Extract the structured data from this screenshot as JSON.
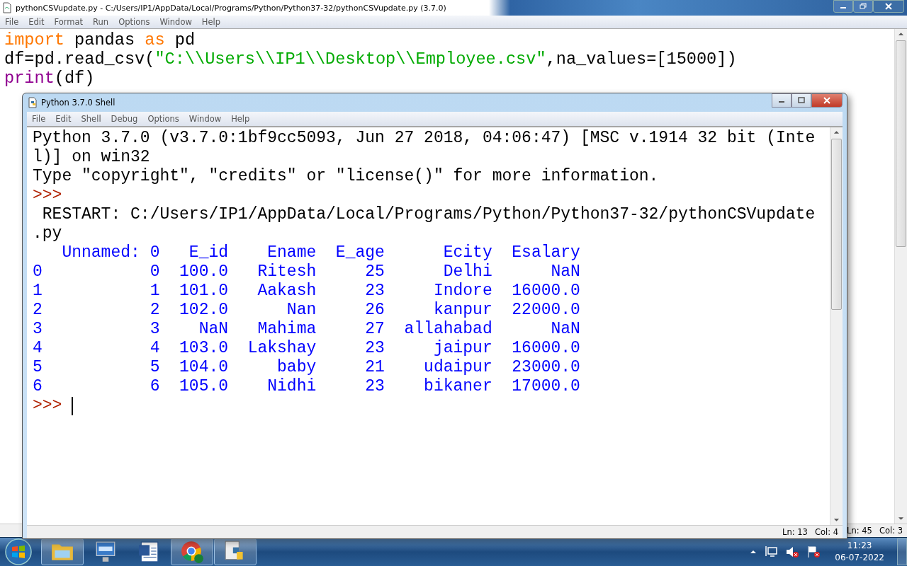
{
  "editor": {
    "title": "pythonCSVupdate.py - C:/Users/IP1/AppData/Local/Programs/Python/Python37-32/pythonCSVupdate.py (3.7.0)",
    "menu": [
      "File",
      "Edit",
      "Format",
      "Run",
      "Options",
      "Window",
      "Help"
    ],
    "code_lines": [
      [
        {
          "kind": "keyword",
          "text": "import"
        },
        {
          "kind": "plain",
          "text": " pandas "
        },
        {
          "kind": "keyword",
          "text": "as"
        },
        {
          "kind": "plain",
          "text": " pd"
        }
      ],
      [
        {
          "kind": "plain",
          "text": "df=pd.read_csv("
        },
        {
          "kind": "string",
          "text": "\"C:\\\\Users\\\\IP1\\\\Desktop\\\\Employee.csv\""
        },
        {
          "kind": "plain",
          "text": ",na_values=[15000])"
        }
      ],
      [
        {
          "kind": "builtin",
          "text": "print"
        },
        {
          "kind": "plain",
          "text": "(df)"
        }
      ]
    ],
    "status": {
      "line": "Ln: 45",
      "col": "Col: 3"
    }
  },
  "shell": {
    "title": "Python 3.7.0 Shell",
    "menu": [
      "File",
      "Edit",
      "Shell",
      "Debug",
      "Options",
      "Window",
      "Help"
    ],
    "lines": [
      {
        "kind": "plain",
        "text": "Python 3.7.0 (v3.7.0:1bf9cc5093, Jun 27 2018, 04:06:47) [MSC v.1914 32 bit (Inte"
      },
      {
        "kind": "plain",
        "text": "l)] on win32"
      },
      {
        "kind": "plain",
        "text": "Type \"copyright\", \"credits\" or \"license()\" for more information."
      },
      {
        "kind": "prompt",
        "text": ">>>"
      },
      {
        "kind": "plain",
        "text": " RESTART: C:/Users/IP1/AppData/Local/Programs/Python/Python37-32/pythonCSVupdate"
      },
      {
        "kind": "plain",
        "text": ".py"
      },
      {
        "kind": "stdout",
        "text": "   Unnamed: 0   E_id    Ename  E_age      Ecity  Esalary"
      },
      {
        "kind": "stdout",
        "text": "0           0  100.0   Ritesh     25      Delhi      NaN"
      },
      {
        "kind": "stdout",
        "text": "1           1  101.0   Aakash     23     Indore  16000.0"
      },
      {
        "kind": "stdout",
        "text": "2           2  102.0      Nan     26     kanpur  22000.0"
      },
      {
        "kind": "stdout",
        "text": "3           3    NaN   Mahima     27  allahabad      NaN"
      },
      {
        "kind": "stdout",
        "text": "4           4  103.0  Lakshay     23     jaipur  16000.0"
      },
      {
        "kind": "stdout",
        "text": "5           5  104.0     baby     21    udaipur  23000.0"
      },
      {
        "kind": "stdout",
        "text": "6           6  105.0    Nidhi     23    bikaner  17000.0"
      },
      {
        "kind": "prompt",
        "text": ">>>",
        "cursor": true
      }
    ],
    "status": {
      "line": "Ln: 13",
      "col": "Col: 4"
    }
  },
  "taskbar": {
    "apps": [
      {
        "kind": "folder",
        "running": true
      },
      {
        "kind": "computer",
        "running": false
      },
      {
        "kind": "document",
        "running": false
      },
      {
        "kind": "browser",
        "running": true
      },
      {
        "kind": "python",
        "running": true
      }
    ],
    "time": "11:23",
    "date": "06-07-2022"
  }
}
